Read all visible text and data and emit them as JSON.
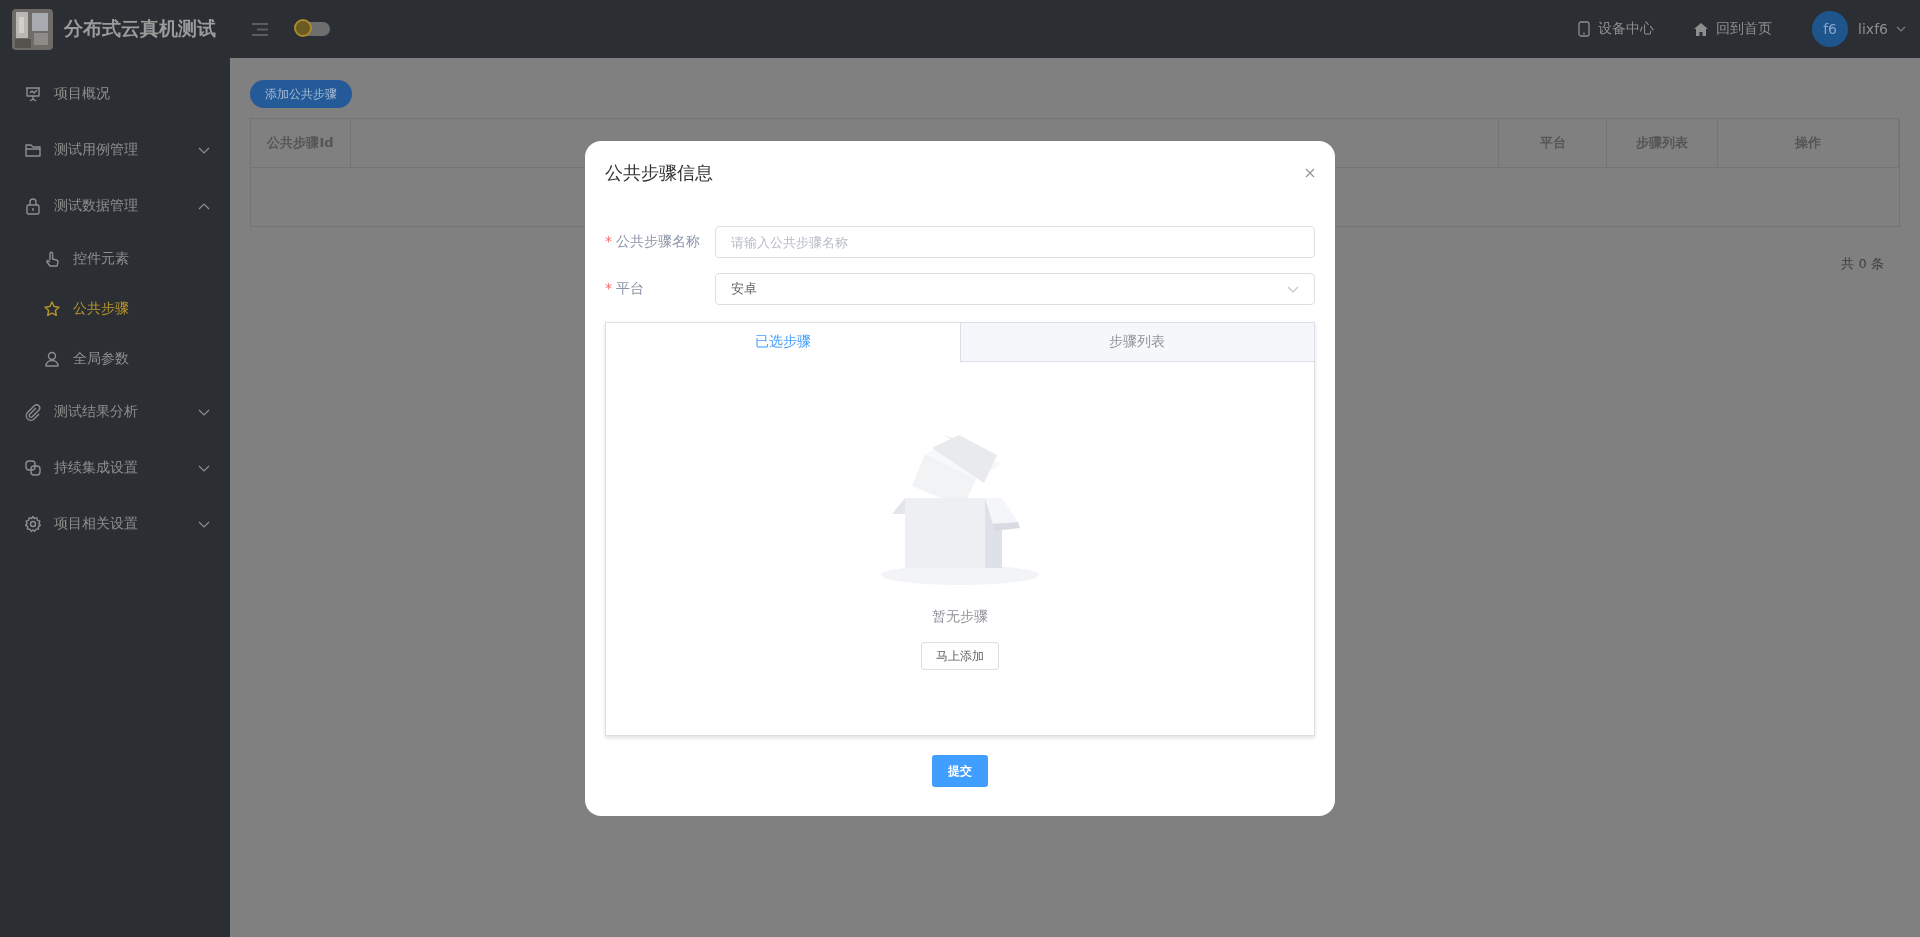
{
  "header": {
    "title": "分布式云真机测试",
    "theme_toggle": {
      "on": false
    },
    "links": [
      {
        "kind": "device",
        "label": "设备中心"
      },
      {
        "kind": "home",
        "label": "回到首页"
      }
    ],
    "user": {
      "avatar": "f6",
      "name": "lixf6"
    }
  },
  "sidebar": {
    "items": [
      {
        "label": "项目概况",
        "selected": false
      },
      {
        "label": "测试用例管理",
        "selected": false,
        "expanded": false
      },
      {
        "label": "测试数据管理",
        "selected": false,
        "expanded": true,
        "children": [
          {
            "label": "控件元素",
            "selected": false
          },
          {
            "label": "公共步骤",
            "selected": true
          },
          {
            "label": "全局参数",
            "selected": false
          }
        ]
      },
      {
        "label": "测试结果分析",
        "selected": false,
        "expanded": false
      },
      {
        "label": "持续集成设置",
        "selected": false,
        "expanded": false
      },
      {
        "label": "项目相关设置",
        "selected": false,
        "expanded": false
      }
    ]
  },
  "toolbar": {
    "add_button": "添加公共步骤"
  },
  "table": {
    "columns": [
      "公共步骤Id",
      "平台",
      "步骤列表",
      "操作"
    ]
  },
  "pagination": {
    "total": "共 0 条"
  },
  "dialog": {
    "title": "公共步骤信息",
    "fields": [
      {
        "kind": "input",
        "label": "公共步骤名称",
        "required_mark": "*",
        "placeholder": "请输入公共步骤名称"
      },
      {
        "kind": "select",
        "label": "平台",
        "required_mark": "*",
        "value": "安卓"
      }
    ],
    "tabs": [
      {
        "label": "已选步骤",
        "selected": true
      },
      {
        "label": "步骤列表",
        "selected": false
      }
    ],
    "empty": {
      "text": "暂无步骤",
      "action": "马上添加"
    },
    "submit": "提交"
  }
}
